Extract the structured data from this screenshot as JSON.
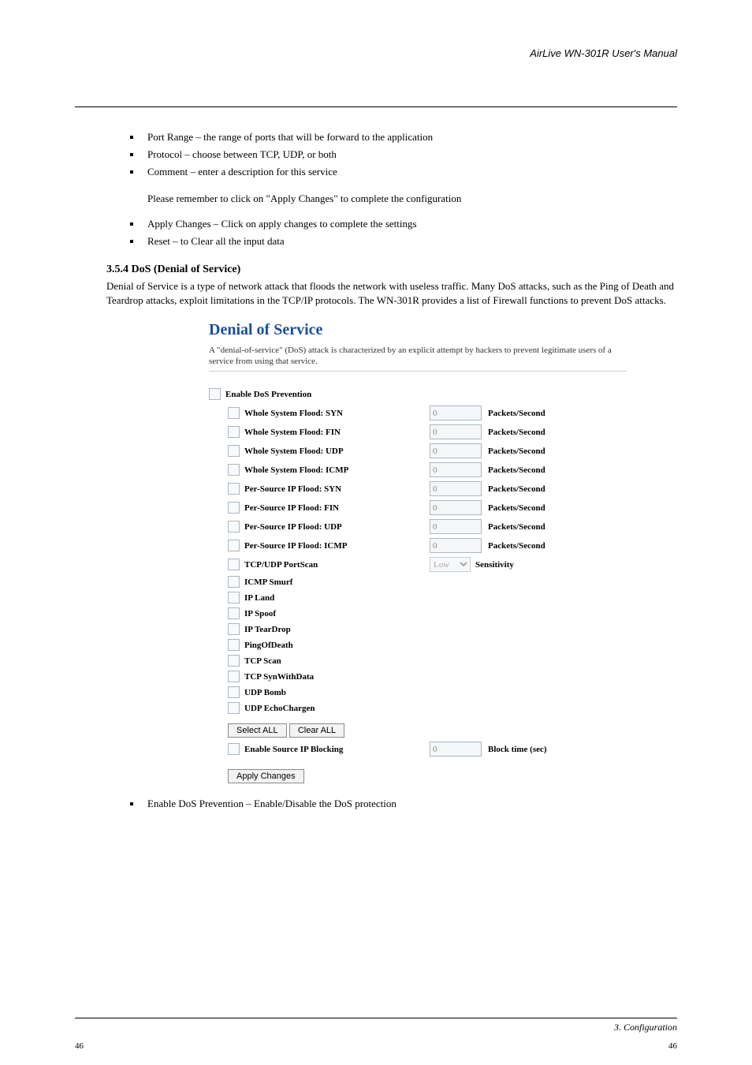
{
  "header": {
    "right": "AirLive WN-301R User's Manual"
  },
  "bullets1": [
    "Port Range – the range of ports that will be forward to the application",
    "Protocol – choose between TCP, UDP, or both",
    "Comment – enter a description for this service"
  ],
  "sub_note": "Please remember to click on \"Apply Changes\" to complete the configuration",
  "bullets2": [
    "Apply Changes – Click on apply changes to complete the settings",
    "Reset – to Clear all the input data"
  ],
  "dos_section": {
    "label": "3.5.4 DoS (Denial of Service)",
    "text": "Denial of Service is a type of network attack that floods the network with useless traffic. Many DoS attacks, such as the Ping of Death and Teardrop attacks, exploit limitations in the TCP/IP protocols. The WN-301R provides a list of Firewall functions to prevent DoS attacks."
  },
  "shot": {
    "title": "Denial of Service",
    "desc": "A \"denial-of-service\" (DoS) attack is characterized by an explicit attempt by hackers to prevent legitimate users of a service from using that service.",
    "enable_label": "Enable DoS Prevention",
    "flood_rows": [
      {
        "label": "Whole System Flood: SYN",
        "value": "0",
        "unit": "Packets/Second"
      },
      {
        "label": "Whole System Flood: FIN",
        "value": "0",
        "unit": "Packets/Second"
      },
      {
        "label": "Whole System Flood: UDP",
        "value": "0",
        "unit": "Packets/Second"
      },
      {
        "label": "Whole System Flood: ICMP",
        "value": "0",
        "unit": "Packets/Second"
      },
      {
        "label": "Per-Source IP Flood: SYN",
        "value": "0",
        "unit": "Packets/Second"
      },
      {
        "label": "Per-Source IP Flood: FIN",
        "value": "0",
        "unit": "Packets/Second"
      },
      {
        "label": "Per-Source IP Flood: UDP",
        "value": "0",
        "unit": "Packets/Second"
      },
      {
        "label": "Per-Source IP Flood: ICMP",
        "value": "0",
        "unit": "Packets/Second"
      }
    ],
    "portscan": {
      "label": "TCP/UDP PortScan",
      "select": "Low",
      "unit": "Sensitivity"
    },
    "simple_rows": [
      "ICMP Smurf",
      "IP Land",
      "IP Spoof",
      "IP TearDrop",
      "PingOfDeath",
      "TCP Scan",
      "TCP SynWithData",
      "UDP Bomb",
      "UDP EchoChargen"
    ],
    "select_all": "Select ALL",
    "clear_all": "Clear ALL",
    "block_row": {
      "label": "Enable Source IP Blocking",
      "value": "0",
      "unit": "Block time (sec)"
    },
    "apply": "Apply Changes"
  },
  "bullets3": [
    "Enable DoS Prevention – Enable/Disable the DoS protection"
  ],
  "footer": {
    "right": "3. Configuration",
    "page_left": "46",
    "page_right": "46"
  }
}
